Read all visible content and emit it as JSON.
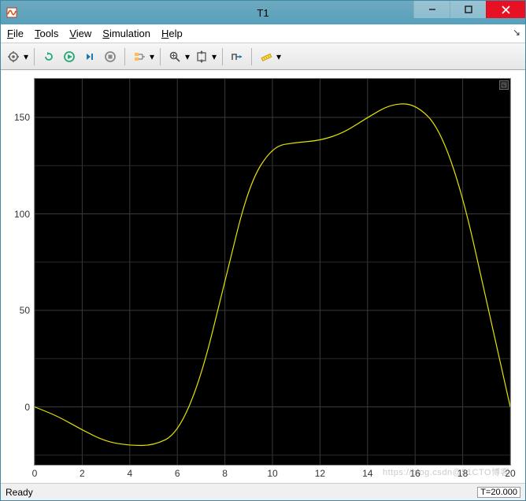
{
  "window": {
    "title": "T1"
  },
  "menu": {
    "file": "File",
    "tools": "Tools",
    "view": "View",
    "simulation": "Simulation",
    "help": "Help"
  },
  "status": {
    "left": "Ready",
    "time": "T=20.000"
  },
  "watermark": "https://blog.csdn@51CTO博客",
  "chart_data": {
    "type": "line",
    "title": "",
    "xlabel": "",
    "ylabel": "",
    "xlim": [
      0,
      20
    ],
    "ylim": [
      -30,
      170
    ],
    "xticks": [
      0,
      2,
      4,
      6,
      8,
      10,
      12,
      14,
      16,
      18,
      20
    ],
    "yticks": [
      0,
      50,
      100,
      150
    ],
    "series": [
      {
        "name": "T1",
        "color": "#e4e400",
        "x": [
          0,
          1,
          2,
          3,
          4,
          5,
          6,
          7,
          8,
          9,
          10,
          11,
          12,
          13,
          14,
          15,
          16,
          17,
          18,
          19,
          20
        ],
        "y": [
          0,
          -5,
          -12,
          -18,
          -20,
          -20,
          -14,
          15,
          65,
          115,
          135,
          137,
          138,
          142,
          150,
          157,
          157,
          145,
          110,
          55,
          0
        ]
      }
    ]
  }
}
